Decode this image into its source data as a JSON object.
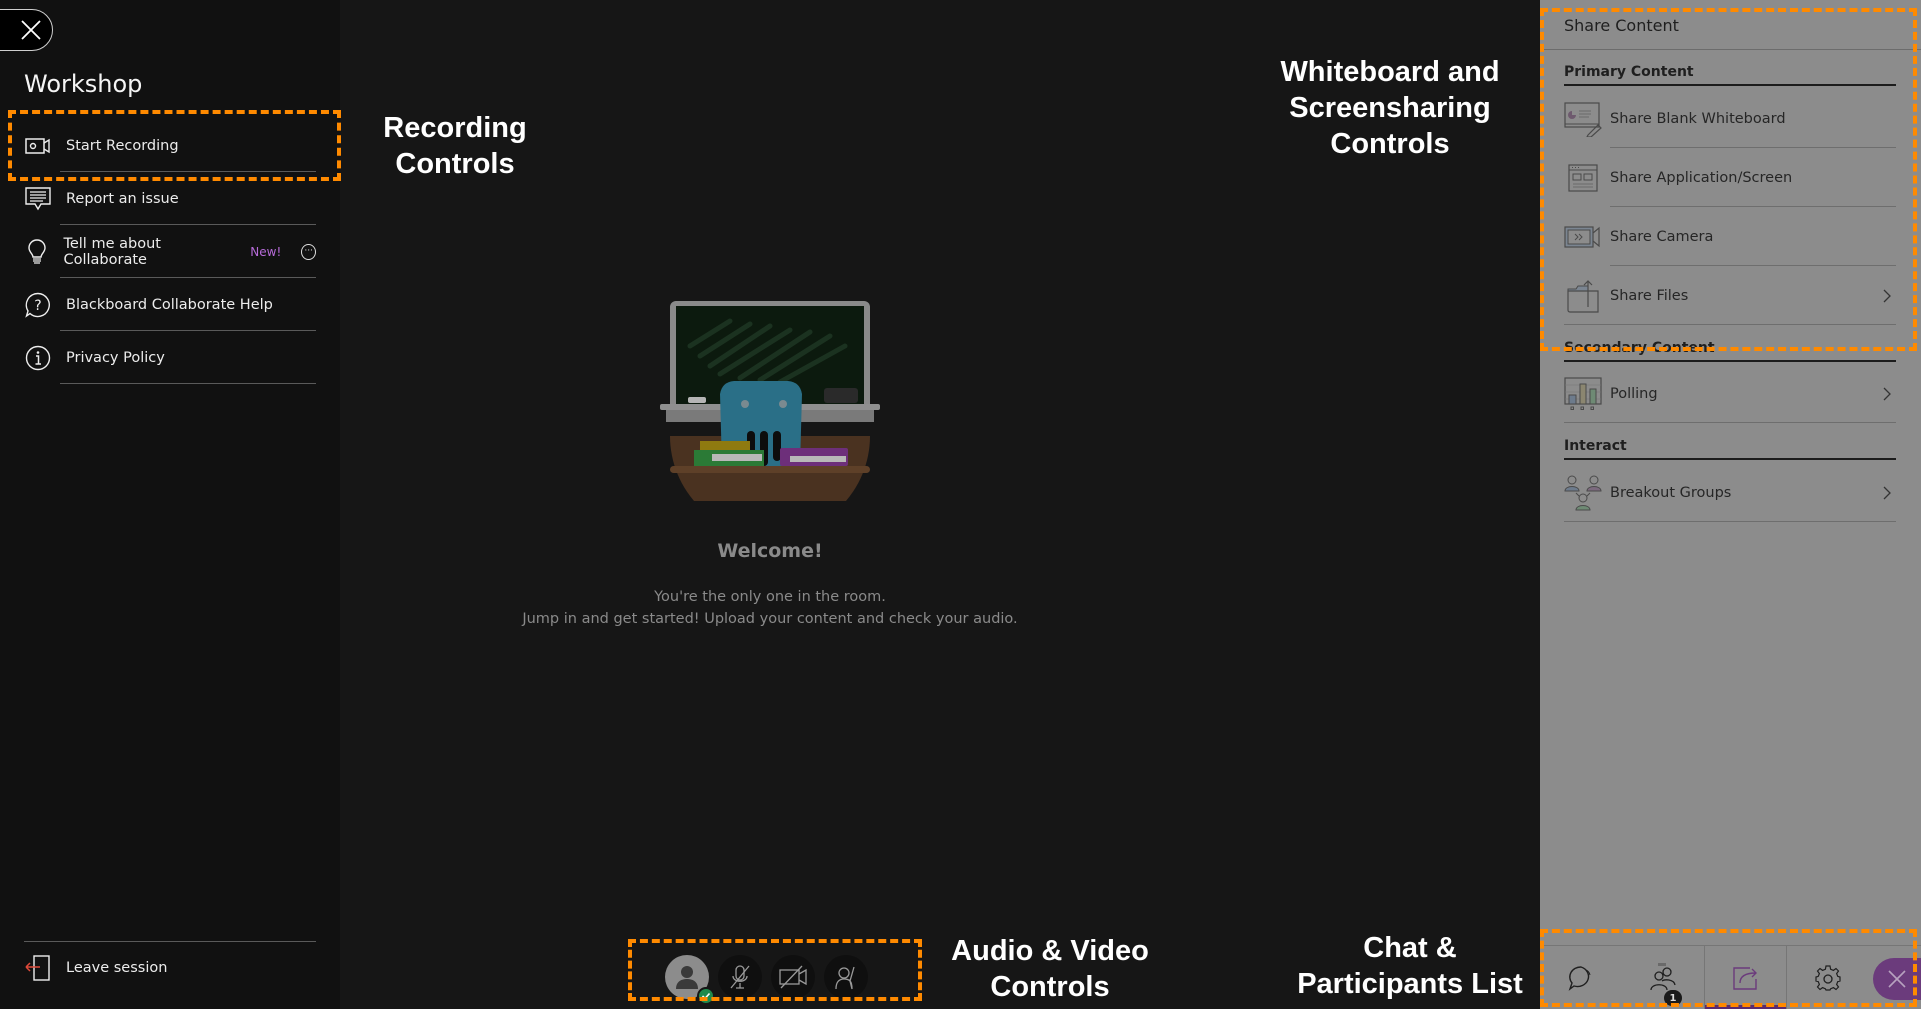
{
  "sidebar": {
    "close_icon": "close-icon",
    "session_title": "Workshop",
    "items": [
      {
        "label": "Start Recording",
        "icon": "camera-record-icon"
      },
      {
        "label": "Report an issue",
        "icon": "report-issue-icon"
      },
      {
        "label": "Tell me about Collaborate",
        "icon": "lightbulb-icon",
        "badge": "New!",
        "more_icon": "more-options-icon"
      },
      {
        "label": "Blackboard Collaborate Help",
        "icon": "help-icon"
      },
      {
        "label": "Privacy Policy",
        "icon": "info-icon"
      }
    ],
    "leave": {
      "label": "Leave session",
      "icon": "leave-session-icon"
    }
  },
  "stage": {
    "welcome_title": "Welcome!",
    "welcome_line1": "You're the only one in the room.",
    "welcome_line2": "Jump in and get started! Upload your content and check your audio.",
    "controls": [
      {
        "name": "my-status-avatar",
        "icon": "avatar-icon",
        "status": "available"
      },
      {
        "name": "microphone-toggle",
        "icon": "microphone-off-icon",
        "state": "off"
      },
      {
        "name": "camera-toggle",
        "icon": "camera-off-icon",
        "state": "off"
      },
      {
        "name": "raise-hand",
        "icon": "raise-hand-icon"
      }
    ]
  },
  "panel": {
    "title": "Share Content",
    "sections": [
      {
        "heading": "Primary Content",
        "items": [
          {
            "label": "Share Blank Whiteboard",
            "icon": "whiteboard-icon",
            "has_submenu": false
          },
          {
            "label": "Share Application/Screen",
            "icon": "screen-share-icon",
            "has_submenu": false
          },
          {
            "label": "Share Camera",
            "icon": "share-camera-icon",
            "has_submenu": false
          },
          {
            "label": "Share Files",
            "icon": "share-files-icon",
            "has_submenu": true
          }
        ]
      },
      {
        "heading": "Secondary Content",
        "items": [
          {
            "label": "Polling",
            "icon": "polling-icon",
            "has_submenu": true
          }
        ]
      },
      {
        "heading": "Interact",
        "items": [
          {
            "label": "Breakout Groups",
            "icon": "breakout-groups-icon",
            "has_submenu": true
          }
        ]
      }
    ],
    "tabs": [
      {
        "name": "chat",
        "icon": "chat-icon"
      },
      {
        "name": "participants",
        "icon": "participants-icon",
        "count": "1"
      },
      {
        "name": "share-content",
        "icon": "share-content-icon",
        "active": true
      },
      {
        "name": "settings",
        "icon": "settings-icon"
      },
      {
        "name": "close-panel",
        "icon": "close-icon"
      }
    ],
    "accent_color": "#6b3b7c"
  },
  "annotations": {
    "recording": "Recording Controls",
    "whiteboard": "Whiteboard and Screensharing Controls",
    "audio_video": "Audio & Video Controls",
    "chat": "Chat & Participants List",
    "recording_lines": [
      "Recording",
      "Controls"
    ],
    "whiteboard_lines": [
      "Whiteboard and",
      "Screensharing",
      "Controls"
    ],
    "audio_video_lines": [
      "Audio & Video",
      "Controls"
    ],
    "chat_lines": [
      "Chat &",
      "Participants List"
    ],
    "highlight_color": "#ff8a00"
  }
}
